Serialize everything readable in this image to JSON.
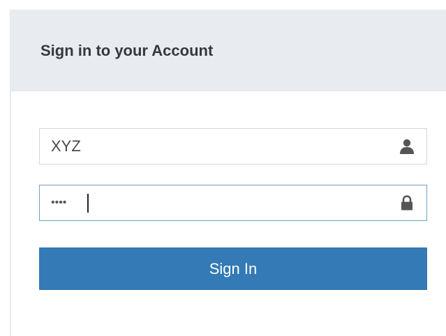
{
  "header": {
    "title": "Sign in to your Account"
  },
  "form": {
    "username": {
      "value": "XYZ",
      "icon": "user-icon"
    },
    "password": {
      "value": "••••",
      "icon": "lock-icon"
    },
    "submit_label": "Sign In"
  },
  "colors": {
    "header_bg": "#e8ebf0",
    "button_bg": "#337ab7",
    "focused_border": "#6fa0c6"
  }
}
